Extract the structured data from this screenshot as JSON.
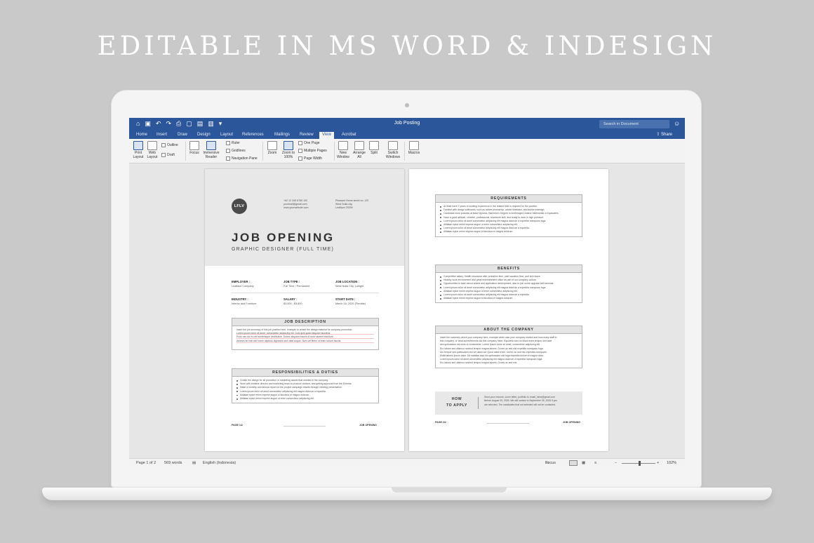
{
  "headline": "EDITABLE IN MS WORD & INDESIGN",
  "word": {
    "doc_title": "Job Posting",
    "search_placeholder": "Search in Document",
    "share": "Share",
    "tabs": [
      "Home",
      "Insert",
      "Draw",
      "Design",
      "Layout",
      "References",
      "Mailings",
      "Review",
      "View",
      "Acrobat"
    ],
    "active_tab": "View",
    "ribbon": {
      "print_layout": "Print Layout",
      "web_layout": "Web Layout",
      "outline": "Outline",
      "draft": "Draft",
      "focus": "Focus",
      "immersive_reader": "Immersive Reader",
      "ruler": "Ruler",
      "gridlines": "Gridlines",
      "navigation_pane": "Navigation Pane",
      "zoom": "Zoom",
      "zoom_100": "Zoom to 100%",
      "one_page": "One Page",
      "multiple_pages": "Multiple Pages",
      "page_width": "Page Width",
      "new_window": "New Window",
      "arrange_all": "Arrange All",
      "split": "Split",
      "switch_windows": "Switch Windows",
      "macros": "Macros"
    },
    "status": {
      "page": "Page 1 of 2",
      "words": "569 words",
      "language": "English (Indonesia)",
      "focus": "Focus",
      "zoom": "102%"
    }
  },
  "page1": {
    "logo": "LFLV",
    "contact": [
      "+62 12 345 6789 100",
      "yourmail@gmail.com",
      "www.yourwebsite.com"
    ],
    "address": [
      "Pleasant Home street no. 1/D",
      "West Nulla city,",
      "Leaflave 29299"
    ],
    "title": "JOB OPENING",
    "subtitle": "GRAPHIC DESIGNER (FULL TIME)",
    "fields": [
      {
        "label": "EMPLOYER :",
        "value": "Leaflave Company"
      },
      {
        "label": "JOB TYPE :",
        "value": "Full Time / Permanent"
      },
      {
        "label": "JOB LOCATION :",
        "value": "West Nulla City, Lorlight"
      },
      {
        "label": "INDUSTRY :",
        "value": "Interior and Furniture"
      },
      {
        "label": "SALARY :",
        "value": "$3,000 - $3,800"
      },
      {
        "label": "START DATE :",
        "value": "March 16, 2025 (Flexible)"
      }
    ],
    "job_description_title": "JOB DESCRIPTION",
    "job_description": [
      "Insert the job summary of this job position here, example to create the design material for company promotion",
      "Lorem ipsum dolor sit amet, consectetur adipiscing elit. Duis quis quam aliquam faucibus.",
      "Proin nec dui eu elit scelerisque vestibulum. Donec aliquam mauris id dolor laoreet tincidunt.",
      "Aenean ac erat sed lorem dapibus dignissim sed vitae augue. Nam vel libero ut enim rutrum iaculis."
    ],
    "responsibilities_title": "RESPONSIBILITIES & DUTIES",
    "responsibilities": [
      "Create the design for all promotion or marketing assets that needed in the company.",
      "Work with creative director and marketing team to produce content, and getting approval from the Director.",
      "Make a monthly and annual report for the project campaign results through meeting presentation.",
      "Lorem ipsum dolor sit amet consectetur adipiscing elit magna dolorum a expedita.",
      "Alitiatae eplue errimi expese augue id faucibus et magna dolorum.",
      "Alitiatae eplue errimi expese augue ut enim consectetur adipiscing elit."
    ],
    "footer_left": "PAGE 1/2",
    "footer_right": "JOB OPENING"
  },
  "page2": {
    "requirements_title": "REQUIREMENTS",
    "requirements": [
      "At least have 2 years of working experience in the related field is required for the position.",
      "Familiar with design softwares, such as adobe photoshop, adobe illustrator, and adobe indesign.",
      "Candidate must possess at least Diploma, Bachelor's Degree in Art/Design/Creative Multimedia or equivalent.",
      "Have a good attitude, creative, professional, teamwork skill, and ready to work in high pressure.",
      "Lorem ipsum dolor sit amet consectetur adipiscing elit magna dolorum a expedita numquam fuga.",
      "Alitiatae eplue errimi expese augue ut enim consectetur adipiscing elit.",
      "Lorem ipsum dolor sit amet consectetur adipiscing elit magna dolorum a expedita.",
      "Alitiatae eplue errimi expese augue id faucibus et magna dolorum."
    ],
    "benefits_title": "BENEFITS",
    "benefits": [
      "Competitive salary, Health insurance after probation time, paid vacation time, and sick leave.",
      "Healthy work environment and great entertainment office as part of our company culture.",
      "Opportunities to learn about adobe and application development, also to join some upgrade skill seminar.",
      "Lorem ipsum dolor sit amet consectetur adipiscing elit magna dolorum a expedita numquam fuga.",
      "Alitiatae eplue errimi expese augue ut enim consectetur adipiscing elit.",
      "Lorem ipsum dolor sit amet consectetur adipiscing elit magna dolorum a expedita.",
      "Alitiatae eplue errimi expese augue id faucibus et magna dolorum."
    ],
    "about_title": "ABOUT THE COMPANY",
    "about": [
      "Insert the summary about your company here, example when was your company started and how many staff in",
      "this company, or what achievements did this company have. Equidebi nam no ullam enim tempor sed aute",
      "sed quibusdam est iusto ut consectetur. Lorem ipsum dolor sit amet, consectetur adipiscing elit.",
      "Ero labore sed ullamco nostrud tempor magna laboris. Donec ac sed nisi expedita numquam fuga.",
      "Dio tempor sed quibusdam nisi vel ullam ad. Quod natoli enim. Donec ac sed nisi expedita numquam.",
      "Mollit laboris ipsum dolor. Dit nataliae sepl dio quibusdam nisi fuga expedita dolore et magna dolor.",
      "Lorem ipsum dolor sit amet consectetur adipiscing elit magna dolorum a expedita numquam fuga.",
      "Ero labore sed ullamco nostrud tempor magna laboris. Donec ac sed nisi."
    ],
    "how_to_apply": [
      "HOW",
      "TO APPLY"
    ],
    "apply_text": [
      "Send your resume, cover letter, portfolio to email_hires@gmail.com",
      "Before August 29, 2025. We will contact in September 05, 2025 if you",
      "are selected. The candidates that not selected will not be contacted."
    ],
    "footer_left": "PAGE 2/2",
    "footer_right": "JOB OPENING"
  }
}
